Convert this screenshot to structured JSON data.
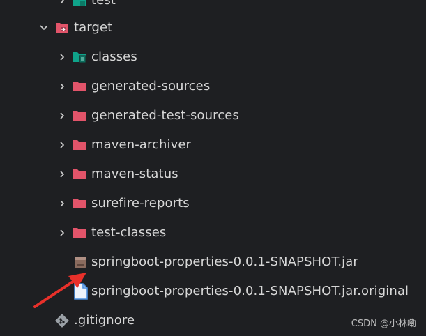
{
  "tree": {
    "items": [
      {
        "label": "test",
        "expanded": false
      },
      {
        "label": "target",
        "expanded": true
      },
      {
        "label": "classes",
        "expanded": false
      },
      {
        "label": "generated-sources",
        "expanded": false
      },
      {
        "label": "generated-test-sources",
        "expanded": false
      },
      {
        "label": "maven-archiver",
        "expanded": false
      },
      {
        "label": "maven-status",
        "expanded": false
      },
      {
        "label": "surefire-reports",
        "expanded": false
      },
      {
        "label": "test-classes",
        "expanded": false
      },
      {
        "label": "springboot-properties-0.0.1-SNAPSHOT.jar"
      },
      {
        "label": "springboot-properties-0.0.1-SNAPSHOT.jar.original"
      },
      {
        "label": ".gitignore"
      }
    ]
  },
  "icons": {
    "test_folder": "test-folder-icon",
    "target_folder": "target-folder-open-icon",
    "classes_folder": "classes-folder-icon",
    "folder": "folder-icon",
    "jar_file": "jar-file-icon",
    "original_file": "document-file-icon",
    "gitignore": "git-icon"
  },
  "colors": {
    "background": "#1e1f22",
    "folder_red": "#e2546a",
    "folder_teal": "#0fa38a",
    "jar_brown": "#8a6b5e",
    "file_blue": "#4a8fe0",
    "arrow_red": "#e8302a"
  },
  "watermark": "CSDN @小林嘞"
}
